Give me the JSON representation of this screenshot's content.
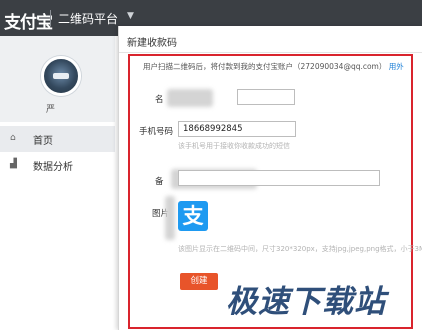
{
  "topbar": {
    "logo": "支付宝",
    "platform": "二维码平台",
    "caret": "▼"
  },
  "sidebar": {
    "username": "严",
    "items": [
      {
        "icon": "home-icon",
        "glyph": "⌂",
        "label": "首页",
        "active": true
      },
      {
        "icon": "bar-chart-icon",
        "glyph": "▟",
        "label": "数据分析",
        "active": false
      }
    ]
  },
  "dialog": {
    "title": "新建收款码",
    "notice": "用户扫描二维码后，将付款到我的支付宝账户（272090034@qq.com）",
    "notice_link": "用外",
    "fields": {
      "name_label": "名",
      "phone_label": "手机号码",
      "phone_value": "18668992845",
      "phone_hint": "该手机号用于接收你收款成功的短信",
      "remark_label": "备",
      "image_label": "图片",
      "image_icon_glyph": "支",
      "image_hint": "该图片显示在二维码中间，尺寸320*320px，支持jpg,jpeg,png格式，小于3M。"
    },
    "create_button": "创建"
  },
  "watermark": "极速下载站",
  "colors": {
    "topbar": "#3b3f44",
    "highlight_border": "#d9242d",
    "create_button": "#e8542a",
    "alipay_blue": "#1e9af1",
    "link": "#1a7ed6"
  }
}
